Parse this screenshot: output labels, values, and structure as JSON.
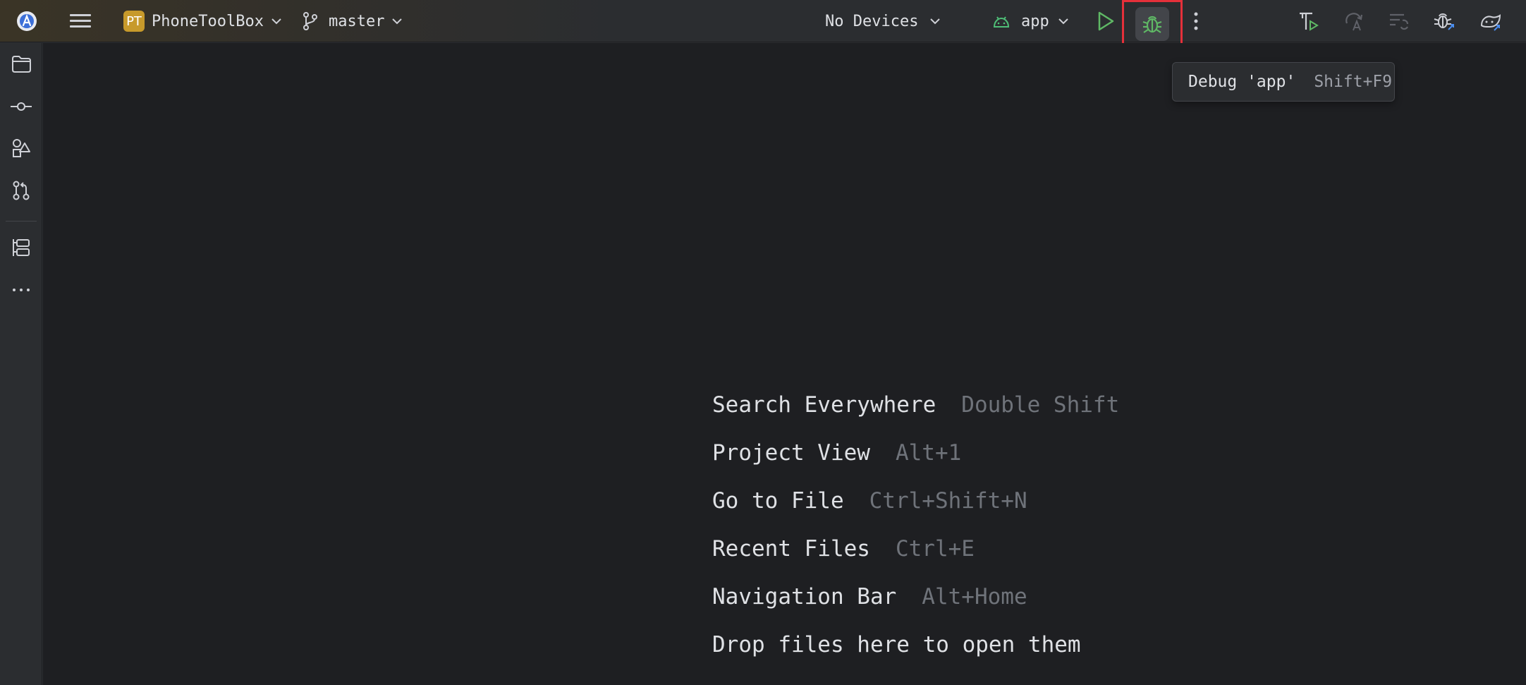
{
  "toolbar": {
    "project_badge": "PT",
    "project_name": "PhoneToolBox",
    "branch": "master",
    "device": "No Devices",
    "run_config": "app"
  },
  "tooltip": {
    "label": "Debug 'app'",
    "shortcut": "Shift+F9"
  },
  "hints": [
    {
      "label": "Search Everywhere",
      "shortcut": "Double Shift"
    },
    {
      "label": "Project View",
      "shortcut": "Alt+1"
    },
    {
      "label": "Go to File",
      "shortcut": "Ctrl+Shift+N"
    },
    {
      "label": "Recent Files",
      "shortcut": "Ctrl+E"
    },
    {
      "label": "Navigation Bar",
      "shortcut": "Alt+Home"
    },
    {
      "label": "Drop files here to open them",
      "shortcut": ""
    }
  ],
  "colors": {
    "accent_highlight": "#e5303a",
    "run_green": "#5fb865",
    "project_badge": "#c79a2b",
    "android_green": "#4fbf77"
  }
}
